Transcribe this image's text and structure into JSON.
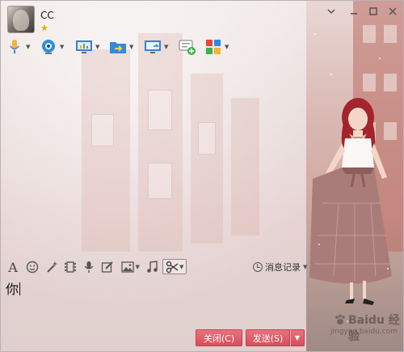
{
  "window": {
    "title": "CC",
    "status_icon": "star-icon"
  },
  "window_controls": [
    "shirt-skin-icon",
    "minimize-icon",
    "maximize-icon",
    "close-icon"
  ],
  "toolbar": {
    "items": [
      {
        "icon": "microphone-icon",
        "has_dropdown": true
      },
      {
        "icon": "webcam-icon",
        "has_dropdown": true
      },
      {
        "icon": "screen-share-icon",
        "has_dropdown": true
      },
      {
        "icon": "send-file-icon",
        "has_dropdown": true
      },
      {
        "icon": "remote-desktop-icon",
        "has_dropdown": true
      },
      {
        "icon": "new-chat-icon",
        "has_dropdown": false
      },
      {
        "icon": "apps-icon",
        "has_dropdown": true
      }
    ]
  },
  "input_toolbar": {
    "items": [
      "font-icon",
      "emoji-icon",
      "magic-wand-icon",
      "video-clip-icon",
      "voice-icon",
      "edit-icon",
      "image-icon",
      "music-icon",
      "screenshot-scissors-icon"
    ],
    "history_label": "消息记录"
  },
  "input": {
    "value": "你"
  },
  "buttons": {
    "close_label": "关闭(C)",
    "send_label": "发送(S)"
  },
  "watermark": {
    "text": "Baidu 经验",
    "sub": "jingyan.baidu.com"
  },
  "colors": {
    "accent": "#d84d5d",
    "star": "#f0a400"
  }
}
